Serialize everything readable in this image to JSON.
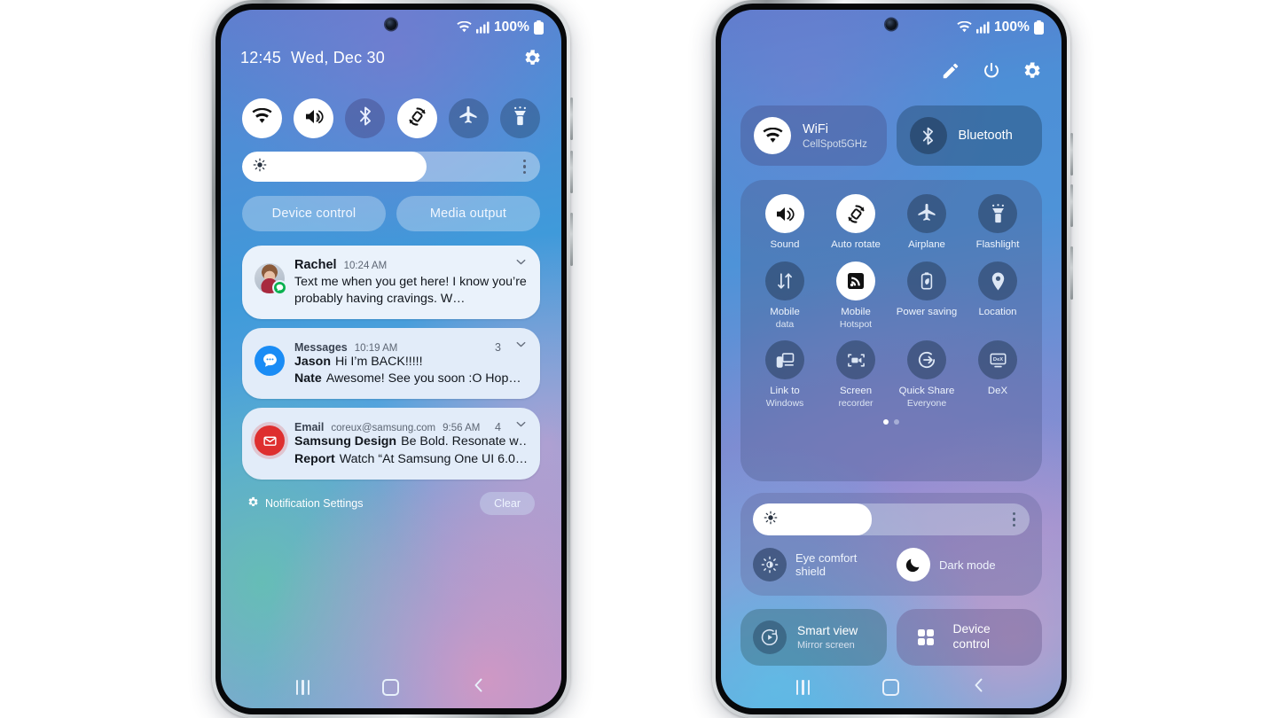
{
  "left_phone": {
    "status_bar": {
      "battery_text": "100%",
      "wifi_icon": "wifi-icon",
      "signal_icon": "signal-bars-icon",
      "battery_icon": "battery-icon"
    },
    "header": {
      "time": "12:45",
      "date": "Wed, Dec 30",
      "settings_icon": "gear-icon"
    },
    "toggles": [
      {
        "name": "wifi",
        "icon": "wifi-icon",
        "state": "on"
      },
      {
        "name": "sound",
        "icon": "volume-icon",
        "state": "on"
      },
      {
        "name": "bluetooth",
        "icon": "bluetooth-icon",
        "state": "off"
      },
      {
        "name": "auto-rotate",
        "icon": "auto-rotate-icon",
        "state": "on"
      },
      {
        "name": "airplane",
        "icon": "airplane-icon",
        "state": "off"
      },
      {
        "name": "flashlight",
        "icon": "flashlight-icon",
        "state": "off"
      }
    ],
    "brightness": {
      "percent": 62,
      "icon": "brightness-icon",
      "menu_icon": "kebab-menu-icon"
    },
    "pills": [
      {
        "label": "Device control"
      },
      {
        "label": "Media output"
      }
    ],
    "notifications": [
      {
        "type": "person",
        "sender": "Rachel",
        "time": "10:24 AM",
        "message": "Text me when you get here! I know you’re probably having cravings. W…",
        "avatar": "contact-photo",
        "badge_icon": "message-badge-icon",
        "chevron": "chevron-down-icon"
      },
      {
        "type": "app",
        "app": "Messages",
        "time": "10:19 AM",
        "count": "3",
        "icon": "messages-icon",
        "chevron": "chevron-down-icon",
        "lines": [
          {
            "sender": "Jason",
            "text": "Hi I’m BACK!!!!!"
          },
          {
            "sender": "Nate",
            "text": "Awesome! See you soon :O Hop…"
          }
        ]
      },
      {
        "type": "app",
        "app": "Email",
        "address": "coreux@samsung.com",
        "time": "9:56 AM",
        "count": "4",
        "icon": "email-icon",
        "chevron": "chevron-down-icon",
        "lines": [
          {
            "sender": "Samsung Design",
            "text": "Be Bold. Resonate w…"
          },
          {
            "sender": "Report",
            "text": "Watch “At Samsung One UI 6.0…"
          }
        ]
      }
    ],
    "footer": {
      "settings_label": "Notification Settings",
      "settings_icon": "gear-icon",
      "clear_label": "Clear"
    },
    "nav": {
      "recents_icon": "recents-icon",
      "home_icon": "home-icon",
      "back_icon": "back-icon"
    }
  },
  "right_phone": {
    "status_bar": {
      "battery_text": "100%",
      "wifi_icon": "wifi-icon",
      "signal_icon": "signal-bars-icon",
      "battery_icon": "battery-icon"
    },
    "actions": [
      {
        "name": "edit",
        "icon": "pencil-icon"
      },
      {
        "name": "power",
        "icon": "power-icon"
      },
      {
        "name": "settings",
        "icon": "gear-icon"
      }
    ],
    "top_tiles": [
      {
        "label": "WiFi",
        "sub": "CellSpot5GHz",
        "icon": "wifi-icon",
        "state": "on"
      },
      {
        "label": "Bluetooth",
        "sub": "",
        "icon": "bluetooth-icon",
        "state": "off"
      }
    ],
    "grid": [
      {
        "label": "Sound",
        "sub": "",
        "icon": "volume-icon",
        "state": "on"
      },
      {
        "label": "Auto rotate",
        "sub": "",
        "icon": "auto-rotate-icon",
        "state": "on"
      },
      {
        "label": "Airplane",
        "sub": "",
        "icon": "airplane-icon",
        "state": "off"
      },
      {
        "label": "Flashlight",
        "sub": "",
        "icon": "flashlight-icon",
        "state": "off"
      },
      {
        "label": "Mobile",
        "sub": "data",
        "icon": "mobile-data-icon",
        "state": "off"
      },
      {
        "label": "Mobile",
        "sub": "Hotspot",
        "icon": "hotspot-icon",
        "state": "on"
      },
      {
        "label": "Power saving",
        "sub": "",
        "icon": "power-saving-icon",
        "state": "off"
      },
      {
        "label": "Location",
        "sub": "",
        "icon": "location-icon",
        "state": "off"
      },
      {
        "label": "Link to",
        "sub": "Windows",
        "icon": "link-to-windows-icon",
        "state": "off"
      },
      {
        "label": "Screen",
        "sub": "recorder",
        "icon": "screen-recorder-icon",
        "state": "off"
      },
      {
        "label": "Quick Share",
        "sub": "Everyone",
        "icon": "quick-share-icon",
        "state": "off"
      },
      {
        "label": "DeX",
        "sub": "",
        "icon": "dex-icon",
        "state": "off"
      }
    ],
    "page_dots": {
      "count": 2,
      "active": 0
    },
    "brightness": {
      "percent": 43,
      "icon": "brightness-icon",
      "menu_icon": "kebab-menu-icon"
    },
    "modes": [
      {
        "label": "Eye comfort shield",
        "icon": "eye-comfort-icon",
        "state": "off"
      },
      {
        "label": "Dark mode",
        "icon": "moon-icon",
        "state": "on"
      }
    ],
    "bottom_tiles": [
      {
        "label": "Smart view",
        "sub": "Mirror screen",
        "icon": "smart-view-icon"
      },
      {
        "label": "Device control",
        "sub": "",
        "icon": "device-control-icon"
      }
    ],
    "nav": {
      "recents_icon": "recents-icon",
      "home_icon": "home-icon",
      "back_icon": "back-icon"
    }
  },
  "colors": {
    "accent_white": "#ffffff",
    "tile_off": "rgba(40,62,92,.55)",
    "notif_bg": "#eaf2fb",
    "message_blue": "#1a8cf5",
    "email_red": "#de2f2f",
    "badge_green": "#0ab14f"
  }
}
